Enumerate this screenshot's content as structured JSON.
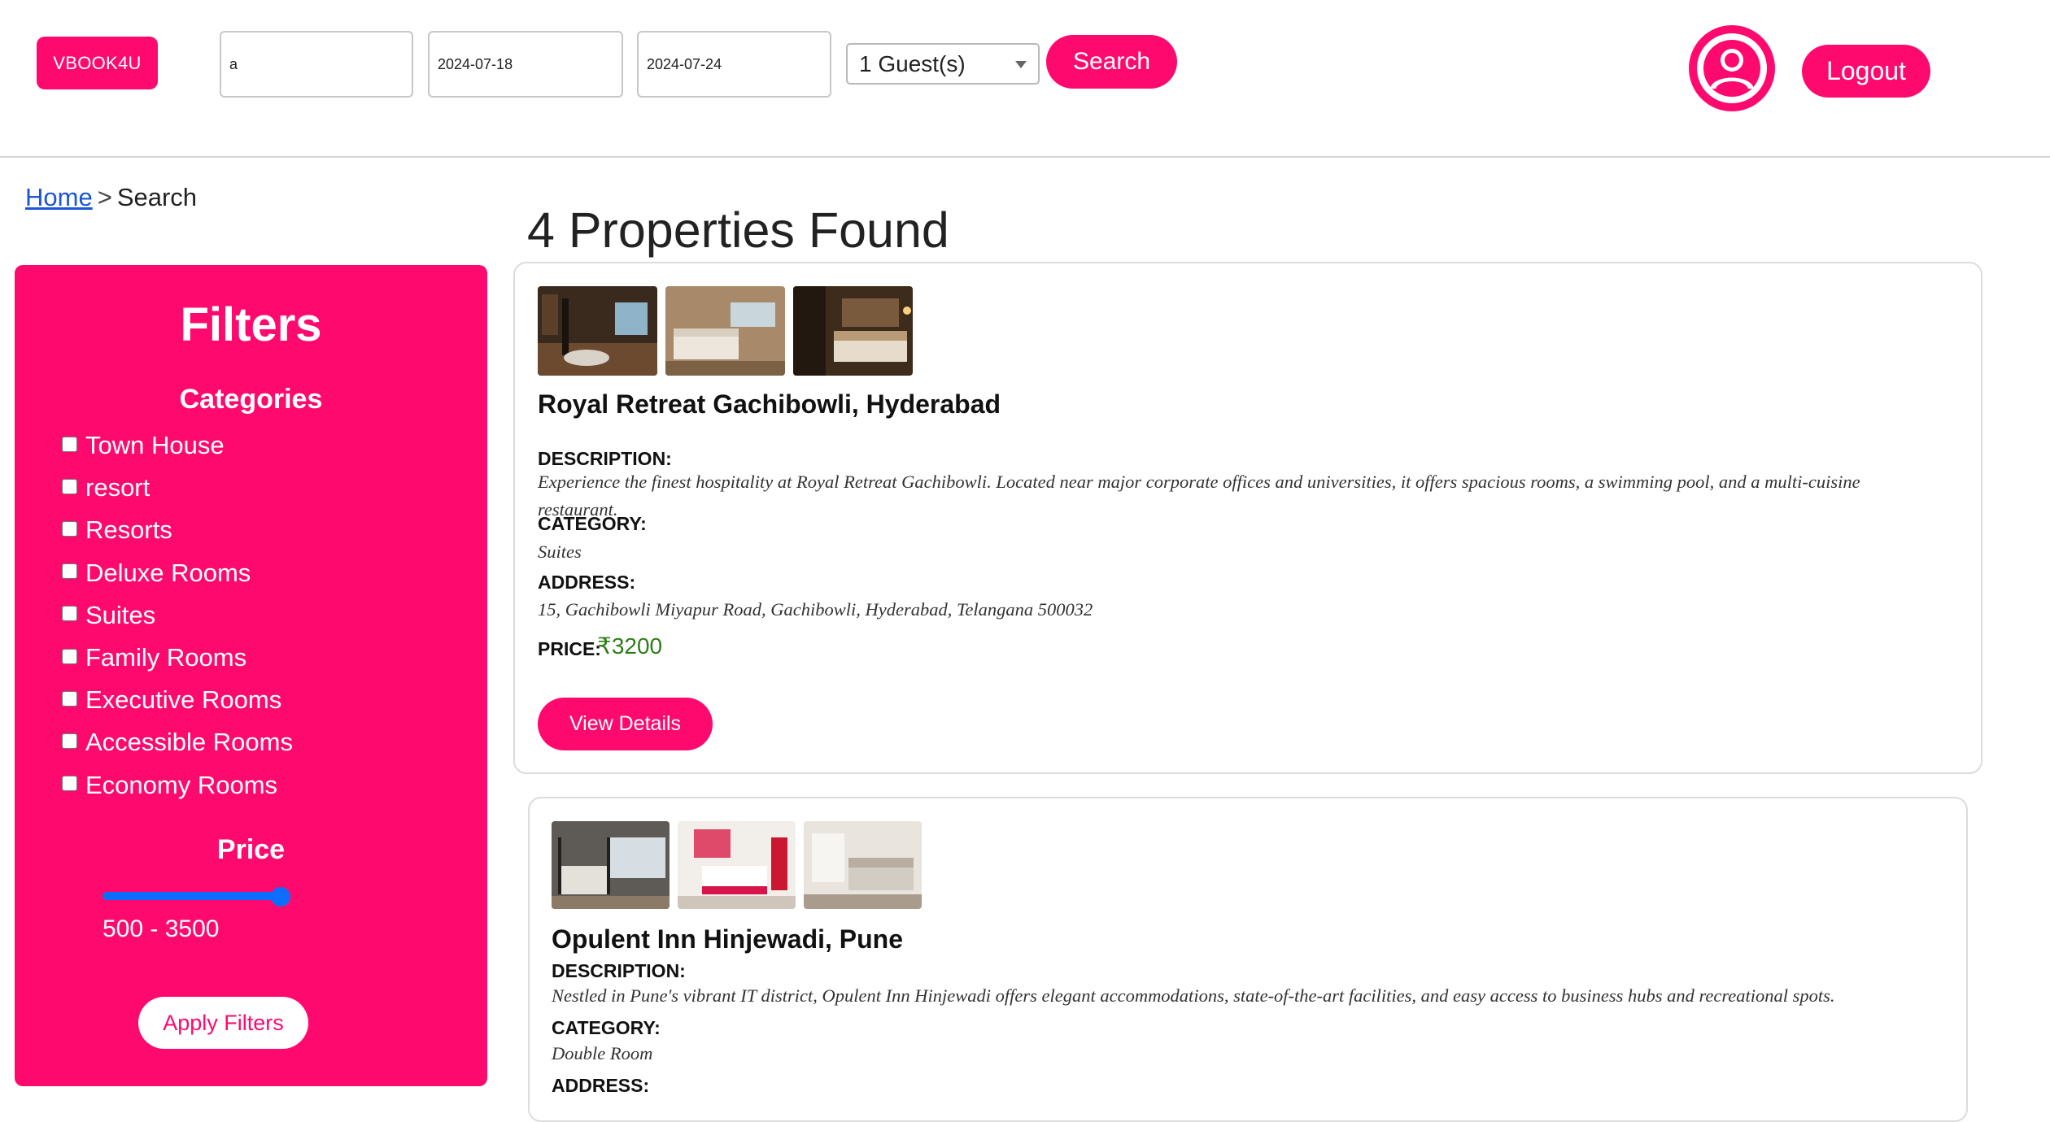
{
  "header": {
    "logo": "VBOOK4U",
    "location_value": "a",
    "checkin_value": "2024-07-18",
    "checkout_value": "2024-07-24",
    "guests_selected": "1 Guest(s)",
    "search_label": "Search",
    "logout_label": "Logout"
  },
  "breadcrumb": {
    "home": "Home",
    "separator": ">",
    "current": "Search"
  },
  "filters": {
    "title": "Filters",
    "categories_title": "Categories",
    "categories": [
      "Town House",
      "resort",
      "Resorts",
      "Deluxe Rooms",
      "Suites",
      "Family Rooms",
      "Executive Rooms",
      "Accessible Rooms",
      "Economy Rooms"
    ],
    "price_title": "Price",
    "price_range": "500 - 3500",
    "apply_label": "Apply Filters"
  },
  "results": {
    "title": "4 Properties Found",
    "properties": [
      {
        "name": "Royal Retreat Gachibowli, Hyderabad",
        "description_label": "DESCRIPTION:",
        "description": "Experience the finest hospitality at Royal Retreat Gachibowli. Located near major corporate offices and universities, it offers spacious rooms, a swimming pool, and a multi-cuisine restaurant.",
        "category_label": "CATEGORY:",
        "category": "Suites",
        "address_label": "ADDRESS:",
        "address": "15, Gachibowli Miyapur Road, Gachibowli, Hyderabad, Telangana 500032",
        "price_label": "PRICE:",
        "price": "₹3200",
        "details_label": "View Details"
      },
      {
        "name": "Opulent Inn Hinjewadi, Pune",
        "description_label": "DESCRIPTION:",
        "description": "Nestled in Pune's vibrant IT district, Opulent Inn Hinjewadi offers elegant accommodations, state-of-the-art facilities, and easy access to business hubs and recreational spots.",
        "category_label": "CATEGORY:",
        "category": "Double Room",
        "address_label": "ADDRESS:"
      }
    ]
  },
  "colors": {
    "brand": "#fe0a6e",
    "link": "#1a56d6",
    "price": "#2e7d16",
    "slider": "#0d6efd"
  },
  "icons": {
    "avatar": "user-avatar-icon",
    "dropdown": "chevron-down-icon"
  }
}
